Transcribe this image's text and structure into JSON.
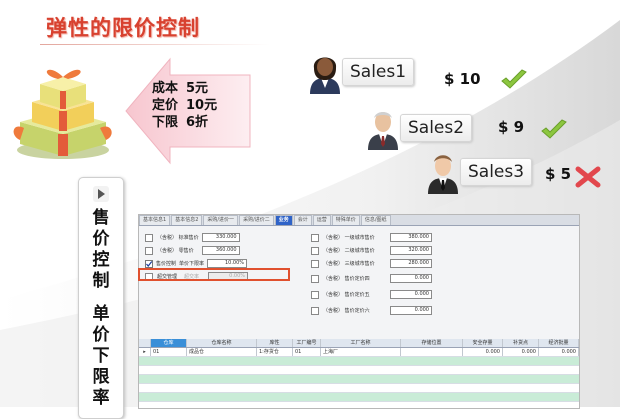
{
  "title": "弹性的限价控制",
  "pricing": {
    "cost_label": "成本",
    "cost_value": "5元",
    "list_label": "定价",
    "list_value": "10元",
    "floor_label": "下限",
    "floor_value": "6折"
  },
  "salespeople": [
    {
      "name": "Sales1",
      "amount": "$ 10",
      "status": "approved"
    },
    {
      "name": "Sales2",
      "amount": "$ 9",
      "status": "approved"
    },
    {
      "name": "Sales3",
      "amount": "$ 5",
      "status": "rejected"
    }
  ],
  "side_label": {
    "part1": [
      "售",
      "价",
      "控",
      "制"
    ],
    "part2": [
      "单",
      "价",
      "下",
      "限",
      "率"
    ]
  },
  "colors": {
    "title": "#d8412f",
    "check": "#8cc63f",
    "cross": "#e2474d",
    "highlight": "#e0502e",
    "active_tab": "#2f63c8"
  },
  "app": {
    "tabs": [
      "基本信息1",
      "基本信息2",
      "采购/进价一",
      "采购/进价二",
      "业务",
      "会计",
      "运营",
      "特殊单价",
      "信息/图纸"
    ],
    "active_tab": 4,
    "left_fields": [
      {
        "label": "（含税）  标准售价",
        "value": "330.000",
        "checked": false
      },
      {
        "label": "（含税）  零售价",
        "value": "360.000",
        "checked": false
      },
      {
        "label": "售价控制",
        "label2": "单价下限率",
        "value": "10.00%",
        "checked": true
      },
      {
        "label": "超交管理",
        "label2": "超交率",
        "value": "0.00%",
        "checked": false,
        "disabled": true
      }
    ],
    "right_fields": [
      {
        "label": "（含税）  一级城市售价",
        "value": "380.000"
      },
      {
        "label": "（含税）  二级城市售价",
        "value": "320.000"
      },
      {
        "label": "（含税）  三级城市售价",
        "value": "280.000"
      },
      {
        "label": "（含税）  售价定价四",
        "value": "0.000"
      },
      {
        "label": "（含税）  售价定价五",
        "value": "0.000"
      },
      {
        "label": "（含税）  售价定价六",
        "value": "0.000"
      }
    ],
    "grid_headers": [
      "仓库",
      "仓库名称",
      "库性",
      "工厂编号",
      "工厂名称",
      "存储位置",
      "安全存量",
      "补货点",
      "经济批量"
    ],
    "grid_rows": [
      [
        "01",
        "成品仓",
        "1:存货仓",
        "01",
        "上海厂",
        "",
        "0.000",
        "0.000",
        "0.000"
      ]
    ]
  }
}
